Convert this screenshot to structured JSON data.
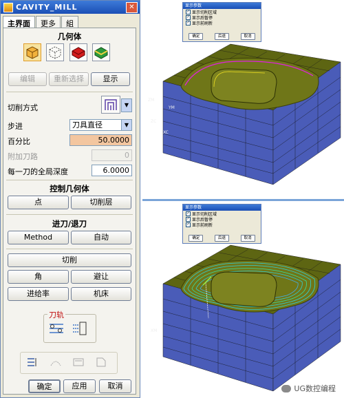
{
  "dialog": {
    "title": "CAVITY_MILL",
    "close": "✕",
    "tabs": [
      "主界面",
      "更多",
      "組"
    ],
    "geometry_title": "几何体",
    "edit_label": "编辑",
    "reselect_label": "重新选择",
    "display_label": "显示",
    "cut_method_label": "切削方式",
    "stepover_label": "步进",
    "stepover_value": "刀具直径",
    "percent_label": "百分比",
    "percent_value": "50.0000",
    "add_pass_label": "附加刀路",
    "add_pass_value": "0",
    "depth_label": "每一刀的全局深度",
    "depth_value": "6.0000",
    "control_title": "控制几何体",
    "point_label": "点",
    "cut_levels_label": "切削层",
    "engage_title": "进刀/退刀",
    "method_label": "Method",
    "auto_label": "自动",
    "cutting_label": "切削",
    "corner_label": "角",
    "avoid_label": "避让",
    "feed_label": "进给率",
    "machine_label": "机床",
    "toolpath_title": "刀轨",
    "ok_label": "确定",
    "apply_label": "应用",
    "cancel_label": "取消"
  },
  "popup": {
    "title": "显示参数",
    "options": [
      "显示切削区域",
      "显示后暂停",
      "显示前刷新"
    ],
    "ok": "确定",
    "back": "后退",
    "cancel": "取消"
  },
  "axis_labels": [
    "ZM",
    "YM",
    "ZC",
    "XC",
    "XM"
  ],
  "watermark": "UG数控编程",
  "colors": {
    "block_top": "#5d6512",
    "block_side": "#4a5cb8",
    "toolpath": "#2fd0d8",
    "boundary": "#e020e0"
  }
}
